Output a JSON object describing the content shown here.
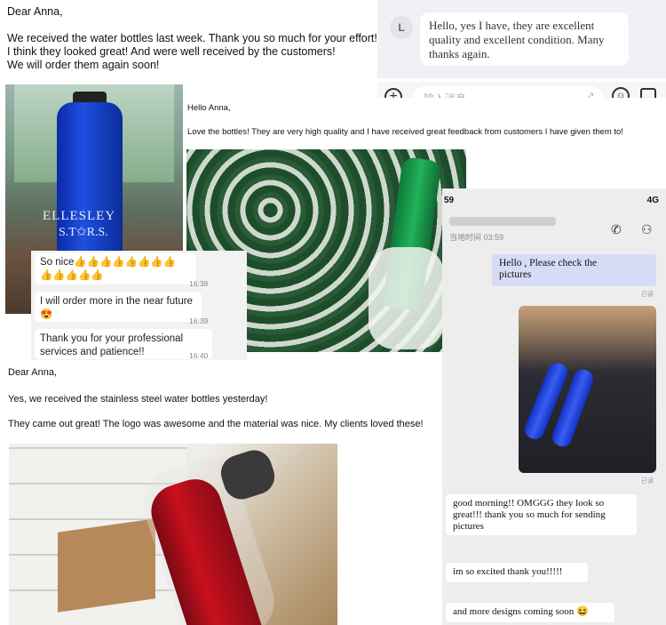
{
  "letter1": {
    "greeting": "Dear Anna,",
    "line1": "We received the water bottles last week. Thank you so much for your effort!",
    "line2": "I think they looked great! And were well received by the customers!",
    "line3": "We will order them again soon!"
  },
  "chat_top": {
    "avatar_letter": "L",
    "message_line1": "Hello, yes I have, they are excellent",
    "message_line2": "quality and excellent condition. Many",
    "message_line3": "thanks again."
  },
  "input_bar": {
    "placeholder": "输入消息......",
    "plus_icon": "+",
    "emoji_icon": "☺",
    "expand_icon": "⤢"
  },
  "photo_blue": {
    "brand_line1": "ELLESLEY",
    "brand_line2": "S.T✩R.S."
  },
  "hello_msg": {
    "greeting": "Hello Anna,",
    "body": "Love the bottles! They are very high quality and I have received great feedback from customers I have given them to!"
  },
  "chat_snip": {
    "msg1_line1": "So nice👍👍👍👍👍👍👍👍",
    "msg1_line2": "👍👍👍👍👍",
    "time1": "16:38",
    "msg2_line1": "I will order more in the near future",
    "msg2_line2": "😍",
    "time2": "16:39",
    "msg3_line1": "Thank you for your professional",
    "msg3_line2": "services and patience!!",
    "time3": "16:40"
  },
  "phone": {
    "status_left": "59",
    "status_right": "4G",
    "last_seen": "当地时间 03:59",
    "out_msg_line1": "Hello          , Please check the",
    "out_msg_line2": "pictures",
    "read_label": "已读",
    "in_msg1_line1": "good morning!! OMGGG they look so",
    "in_msg1_line2": "great!!! thank you so much for sending",
    "in_msg1_line3": "pictures",
    "in_msg2": "im so excited thank you!!!!!",
    "in_msg3": "and more designs coming soon 😆"
  },
  "letter2": {
    "greeting": "Dear Anna,",
    "line1": "Yes, we received the stainless steel water bottles yesterday!",
    "line2": "They came out great! The logo was awesome and the material was nice. My clients loved these!"
  }
}
